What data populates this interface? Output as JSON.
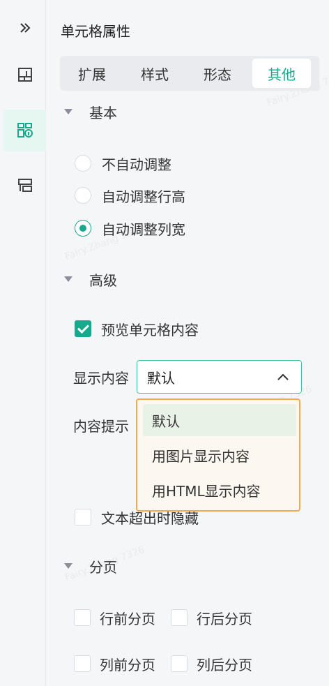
{
  "panel_title": "单元格属性",
  "tabs": [
    "扩展",
    "样式",
    "形态",
    "其他"
  ],
  "sections": {
    "basic": "基本",
    "advanced": "高级",
    "pagination": "分页"
  },
  "resize_options": [
    "不自动调整",
    "自动调整行高",
    "自动调整列宽"
  ],
  "preview_cell_content": "预览单元格内容",
  "display_content": {
    "label": "显示内容",
    "value": "默认",
    "options": [
      "默认",
      "用图片显示内容",
      "用HTML显示内容"
    ]
  },
  "content_tooltip_label": "内容提示",
  "hide_overflow_text": "文本超出时隐藏",
  "page_break": {
    "before_row": "行前分页",
    "after_row": "行后分页",
    "before_col": "列前分页",
    "after_col": "列后分页"
  },
  "watermark": "Fairy.Zhang 7326",
  "colors": {
    "accent": "#16a98b",
    "dropdown_border": "#f2aa4c"
  }
}
